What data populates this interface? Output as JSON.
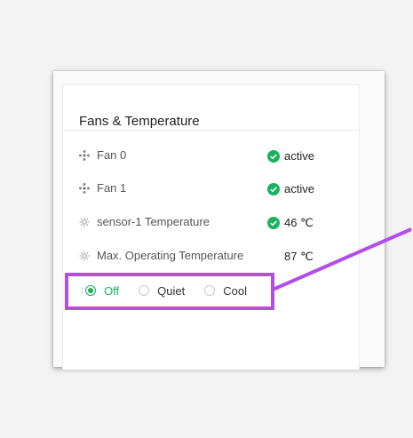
{
  "panel": {
    "title": "Fans & Temperature",
    "rows": [
      {
        "icon": "fan-icon",
        "label": "Fan 0",
        "value": "active",
        "status_icon": "check-circle-icon"
      },
      {
        "icon": "fan-icon",
        "label": "Fan 1",
        "value": "active",
        "status_icon": "check-circle-icon"
      },
      {
        "icon": "sensor-icon",
        "label": "sensor-1 Temperature",
        "value": "46 ℃",
        "status_icon": "check-circle-icon"
      },
      {
        "icon": "sensor-icon",
        "label": "Max. Operating Temperature",
        "value": "87 ℃"
      }
    ],
    "fan_mode": {
      "options": [
        "Off",
        "Quiet",
        "Cool"
      ],
      "selected": "Off"
    }
  },
  "colors": {
    "accent_green": "#19b35e",
    "highlight_purple": "#b24dea"
  }
}
